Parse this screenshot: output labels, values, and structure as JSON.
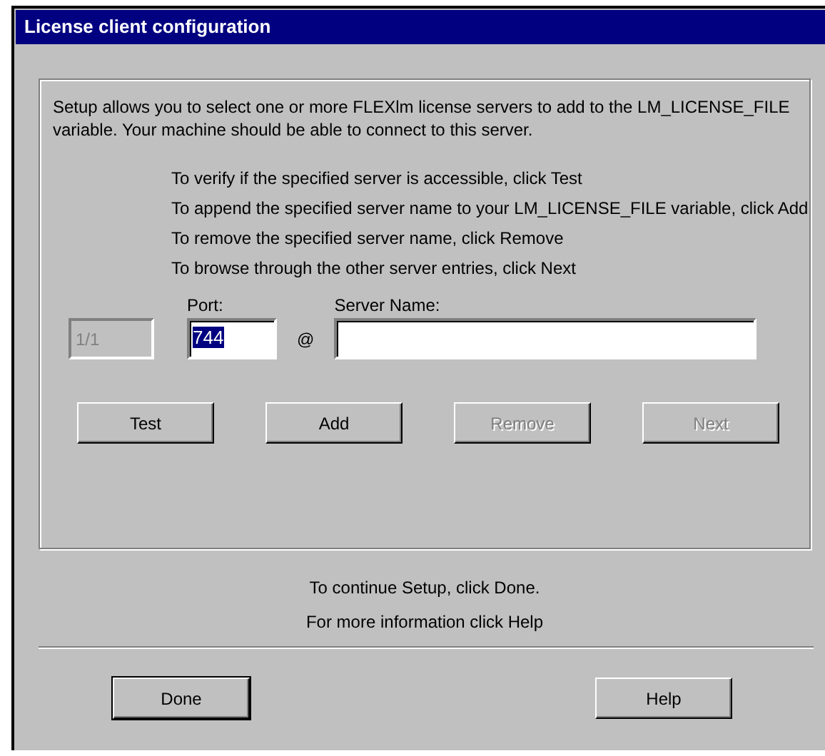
{
  "window": {
    "title": "License client configuration"
  },
  "intro": "Setup allows you to select one or more FLEXlm license servers to add to the LM_LICENSE_FILE variable. Your machine should be able to connect to this server.",
  "instructions": [
    "To verify if the specified server is accessible, click Test",
    "To append the specified server name to your LM_LICENSE_FILE variable, click Add",
    "To remove the specified server name, click Remove",
    "To browse through the other server entries, click Next"
  ],
  "counter": {
    "value": "1/1",
    "disabled": true
  },
  "port": {
    "label": "Port:",
    "value": "744",
    "text_selected": true
  },
  "at_sign": "@",
  "server": {
    "label": "Server Name:"
  },
  "actions": [
    {
      "label": "Test",
      "disabled": false
    },
    {
      "label": "Add",
      "disabled": false
    },
    {
      "label": "Remove",
      "disabled": true
    },
    {
      "label": "Next",
      "disabled": true
    }
  ],
  "footer": [
    "To continue Setup, click Done.",
    "For more information click Help"
  ],
  "buttons": [
    {
      "label": "Done",
      "default": true
    },
    {
      "label": "Help",
      "default": false
    }
  ]
}
